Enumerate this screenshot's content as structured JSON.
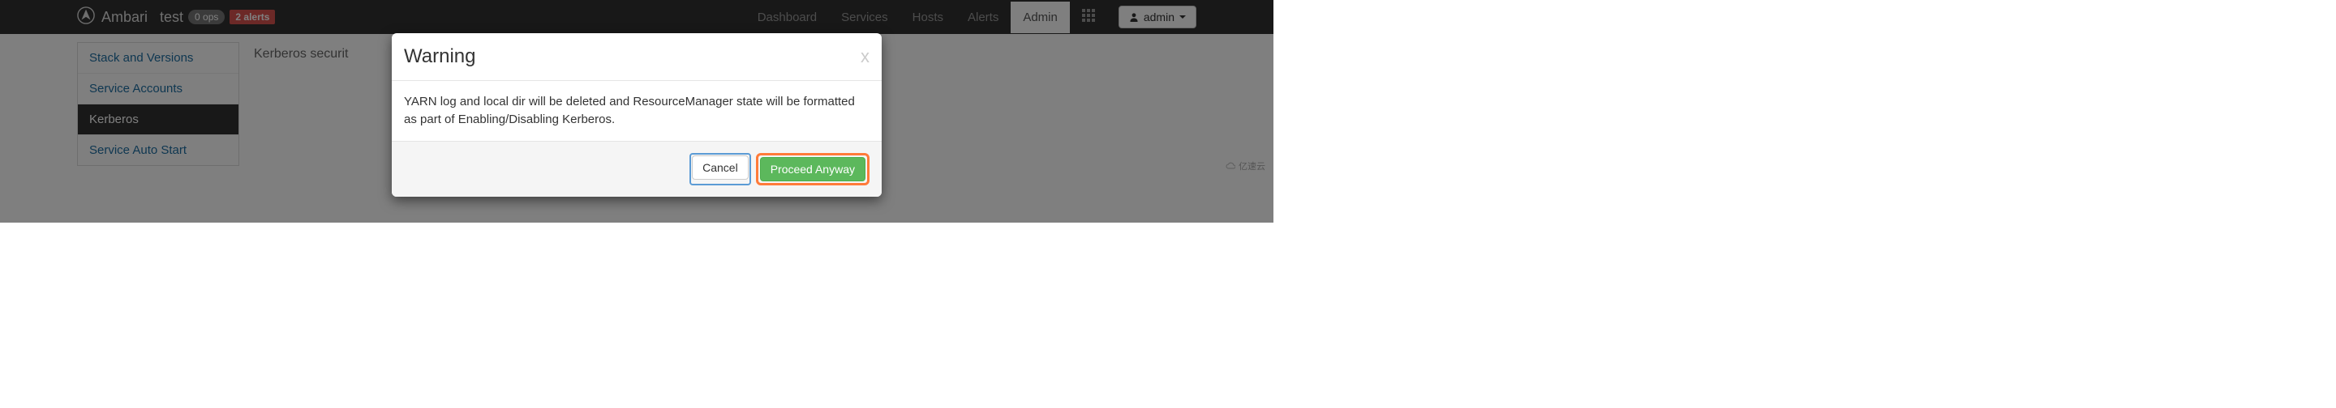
{
  "navbar": {
    "brand": "Ambari",
    "cluster": "test",
    "ops": "0 ops",
    "alerts": "2 alerts",
    "links": [
      "Dashboard",
      "Services",
      "Hosts",
      "Alerts",
      "Admin"
    ],
    "active_link_index": 4,
    "user_label": "admin"
  },
  "sidebar": {
    "items": [
      "Stack and Versions",
      "Service Accounts",
      "Kerberos",
      "Service Auto Start"
    ],
    "active_index": 2
  },
  "main": {
    "heading_visible_prefix": "Kerberos securit"
  },
  "modal": {
    "title": "Warning",
    "close_glyph": "x",
    "body": "YARN log and local dir will be deleted and ResourceManager state will be formatted as part of Enabling/Disabling Kerberos.",
    "cancel_label": "Cancel",
    "proceed_label": "Proceed Anyway"
  },
  "watermark": "亿速云"
}
